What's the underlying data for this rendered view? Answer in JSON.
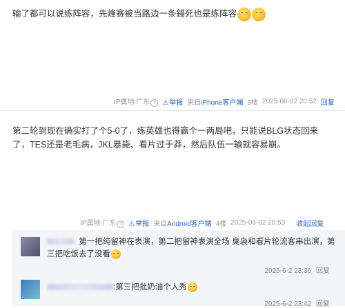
{
  "posts": [
    {
      "text": "输了都可以说练阵容，先峰赛被当路边一条鍚死也是练阵容",
      "emojis": [
        "smile-emoji",
        "smile-emoji"
      ],
      "ip_label": "IP属地:广东",
      "report": "举报",
      "source": "来自iPhone客户端",
      "floor": "3楼",
      "time": "2025-06-02 20:52",
      "reply": "回复"
    },
    {
      "text": "第二轮到现在确实打了个5-0了，练英雄也得赢个一两局吧，只能说BLG状态回来了，TES还是老毛病，JKL暴毙、看片过于莽，然后队伍一输就容易崩。",
      "ip_label": "IP属地:广东",
      "report": "举报",
      "source": "来自Android客户端",
      "floor": "4楼",
      "time": "2025-06-02 20:53",
      "collapse": "收起回复"
    }
  ],
  "replies": [
    {
      "text": "第一把纯留神在表演，第二把留神表演全场 臭袅和看片轮流客串出演，第三把吃饭去了没看",
      "time": "2025-6-2 23:36",
      "reply": "回复"
    },
    {
      "text": ":第三把批奶油个人秀",
      "time": "2025-6-2 23:42",
      "reply": "回复"
    }
  ]
}
